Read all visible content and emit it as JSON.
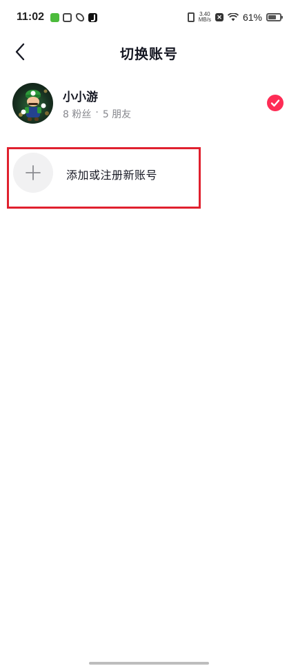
{
  "status_bar": {
    "time": "11:02",
    "speed_value": "3.40",
    "speed_unit": "MB/s",
    "battery_percent": "61%",
    "battery_level": 0.61,
    "notification_icons": [
      "app-green-icon",
      "box-icon",
      "link-icon",
      "tiktok-icon"
    ]
  },
  "nav": {
    "title": "切换账号"
  },
  "account": {
    "name": "小小游",
    "followers": "8 粉丝",
    "separator": "·",
    "friends": "5 朋友",
    "selected": true,
    "check_color": "#fe2c55"
  },
  "add_account": {
    "label": "添加或注册新账号"
  },
  "colors": {
    "highlight_box": "#e0202e",
    "accent": "#fe2c55"
  }
}
